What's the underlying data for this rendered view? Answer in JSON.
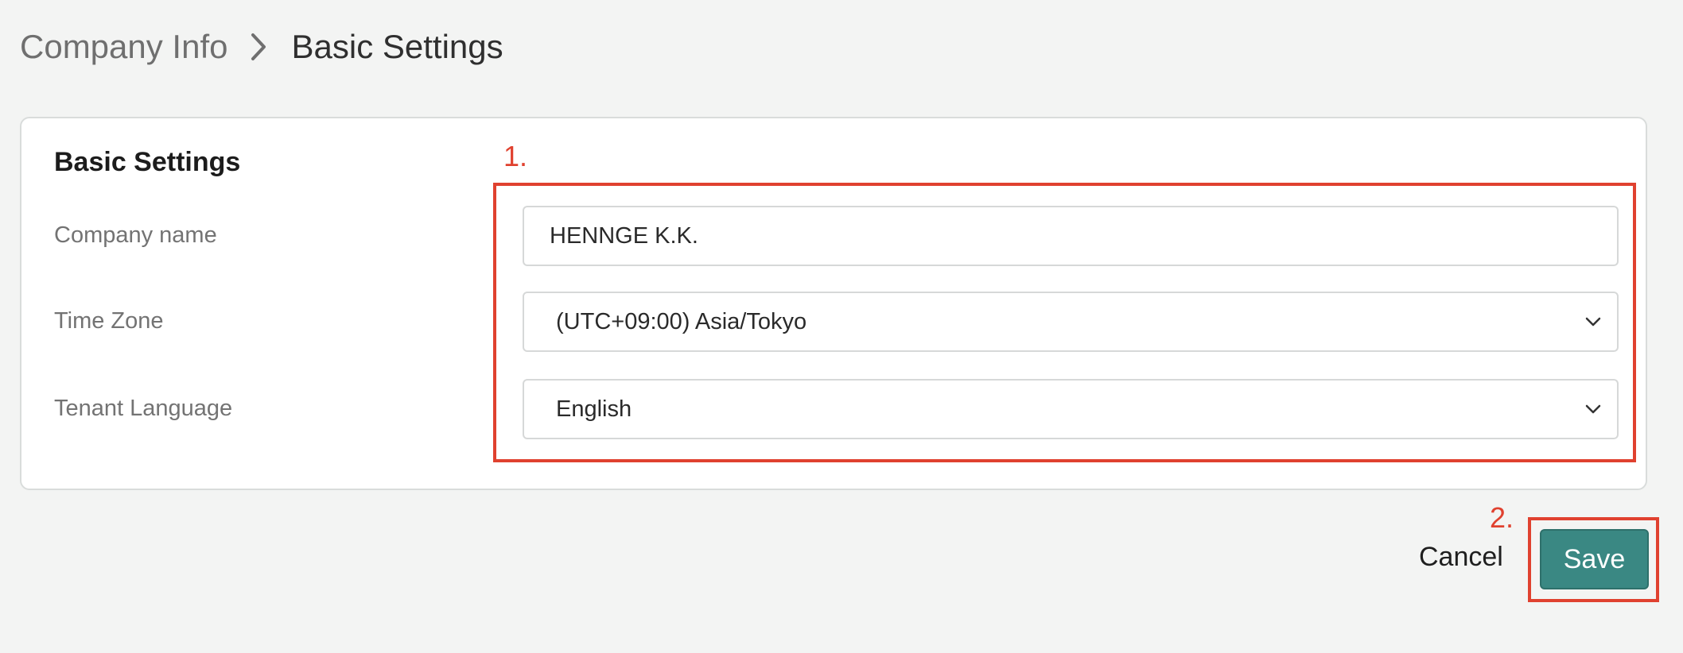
{
  "breadcrumb": {
    "parent": "Company Info",
    "current": "Basic Settings",
    "separator_icon": "chevron-right-icon"
  },
  "card": {
    "title": "Basic Settings",
    "fields": {
      "company_name": {
        "label": "Company name",
        "value": "HENNGE K.K."
      },
      "time_zone": {
        "label": "Time Zone",
        "value": "(UTC+09:00) Asia/Tokyo"
      },
      "tenant_language": {
        "label": "Tenant Language",
        "value": "English"
      }
    }
  },
  "actions": {
    "cancel_label": "Cancel",
    "save_label": "Save"
  },
  "annotations": {
    "step1": "1.",
    "step2": "2.",
    "color": "#e0412f"
  },
  "colors": {
    "background": "#f3f4f3",
    "primary_button": "#3a8883",
    "annotation": "#e0412f"
  }
}
